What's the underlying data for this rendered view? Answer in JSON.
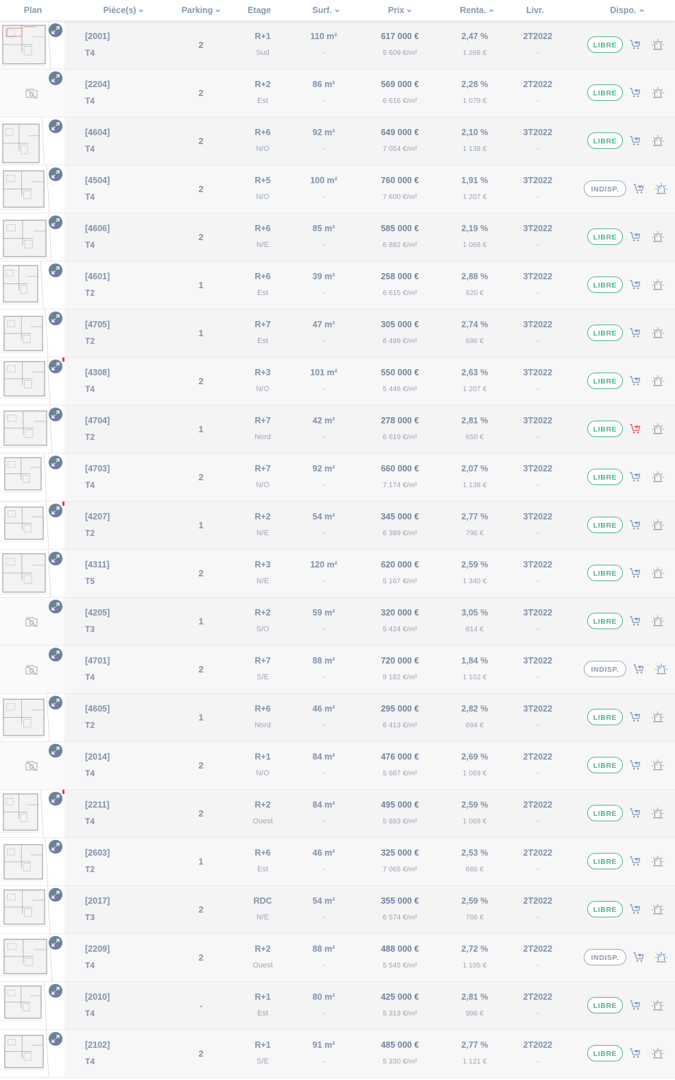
{
  "headers": {
    "plan": "Plan",
    "pieces": "Pièce(s)",
    "parking": "Parking",
    "etage": "Etage",
    "surf": "Surf.",
    "prix": "Prix",
    "renta": "Renta.",
    "livr": "Livr.",
    "dispo": "Dispo."
  },
  "colors": {
    "libre": "#4fb487",
    "indisp": "#9aa7b8",
    "cart_active": "#e05a4f",
    "zoom_bg": "#6c8099"
  },
  "rows": [
    {
      "ref": "[2001]",
      "type": "T4",
      "parking": "2",
      "etage": "R+1",
      "orient": "Sud",
      "surf": "110 m²",
      "surf_sub": "-",
      "prix": "617 000 €",
      "m2": "5 609 €/m²",
      "renta": "2,47 %",
      "loyer": "1 268 €",
      "livr": "2T2022",
      "livr_sub": "-",
      "dispo": "LIBRE",
      "plan": "image",
      "cart_active": false,
      "flag": false
    },
    {
      "ref": "[2204]",
      "type": "T4",
      "parking": "2",
      "etage": "R+2",
      "orient": "Est",
      "surf": "86 m²",
      "surf_sub": "-",
      "prix": "569 000 €",
      "m2": "6 616 €/m²",
      "renta": "2,28 %",
      "loyer": "1 079 €",
      "livr": "2T2022",
      "livr_sub": "-",
      "dispo": "LIBRE",
      "plan": "none",
      "cart_active": false,
      "flag": false
    },
    {
      "ref": "[4604]",
      "type": "T4",
      "parking": "2",
      "etage": "R+6",
      "orient": "N/O",
      "surf": "92 m²",
      "surf_sub": "-",
      "prix": "649 000 €",
      "m2": "7 054 €/m²",
      "renta": "2,10 %",
      "loyer": "1 138 €",
      "livr": "3T2022",
      "livr_sub": "-",
      "dispo": "LIBRE",
      "plan": "image",
      "cart_active": false,
      "flag": false
    },
    {
      "ref": "[4504]",
      "type": "T4",
      "parking": "2",
      "etage": "R+5",
      "orient": "N/O",
      "surf": "100 m²",
      "surf_sub": "-",
      "prix": "760 000 €",
      "m2": "7 600 €/m²",
      "renta": "1,91 %",
      "loyer": "1 207 €",
      "livr": "3T2022",
      "livr_sub": "-",
      "dispo": "INDISP.",
      "plan": "image",
      "cart_active": false,
      "flag": false
    },
    {
      "ref": "[4606]",
      "type": "T4",
      "parking": "2",
      "etage": "R+6",
      "orient": "N/E",
      "surf": "85 m²",
      "surf_sub": "-",
      "prix": "585 000 €",
      "m2": "6 882 €/m²",
      "renta": "2,19 %",
      "loyer": "1 068 €",
      "livr": "3T2022",
      "livr_sub": "-",
      "dispo": "LIBRE",
      "plan": "image",
      "cart_active": false,
      "flag": false
    },
    {
      "ref": "[4601]",
      "type": "T2",
      "parking": "1",
      "etage": "R+6",
      "orient": "Est",
      "surf": "39 m²",
      "surf_sub": "-",
      "prix": "258 000 €",
      "m2": "6 615 €/m²",
      "renta": "2,88 %",
      "loyer": "620 €",
      "livr": "3T2022",
      "livr_sub": "-",
      "dispo": "LIBRE",
      "plan": "image",
      "cart_active": false,
      "flag": false
    },
    {
      "ref": "[4705]",
      "type": "T2",
      "parking": "1",
      "etage": "R+7",
      "orient": "Est",
      "surf": "47 m²",
      "surf_sub": "-",
      "prix": "305 000 €",
      "m2": "6 489 €/m²",
      "renta": "2,74 %",
      "loyer": "696 €",
      "livr": "3T2022",
      "livr_sub": "-",
      "dispo": "LIBRE",
      "plan": "image",
      "cart_active": false,
      "flag": false
    },
    {
      "ref": "[4308]",
      "type": "T4",
      "parking": "2",
      "etage": "R+3",
      "orient": "N/O",
      "surf": "101 m²",
      "surf_sub": "-",
      "prix": "550 000 €",
      "m2": "5 446 €/m²",
      "renta": "2,63 %",
      "loyer": "1 207 €",
      "livr": "3T2022",
      "livr_sub": "-",
      "dispo": "LIBRE",
      "plan": "image",
      "cart_active": false,
      "flag": true
    },
    {
      "ref": "[4704]",
      "type": "T2",
      "parking": "1",
      "etage": "R+7",
      "orient": "Nord",
      "surf": "42 m²",
      "surf_sub": "-",
      "prix": "278 000 €",
      "m2": "6 619 €/m²",
      "renta": "2,81 %",
      "loyer": "650 €",
      "livr": "3T2022",
      "livr_sub": "-",
      "dispo": "LIBRE",
      "plan": "image",
      "cart_active": true,
      "flag": false
    },
    {
      "ref": "[4703]",
      "type": "T4",
      "parking": "2",
      "etage": "R+7",
      "orient": "N/O",
      "surf": "92 m²",
      "surf_sub": "-",
      "prix": "660 000 €",
      "m2": "7 174 €/m²",
      "renta": "2,07 %",
      "loyer": "1 138 €",
      "livr": "3T2022",
      "livr_sub": "-",
      "dispo": "LIBRE",
      "plan": "image",
      "cart_active": false,
      "flag": false
    },
    {
      "ref": "[4207]",
      "type": "T2",
      "parking": "1",
      "etage": "R+2",
      "orient": "N/E",
      "surf": "54 m²",
      "surf_sub": "-",
      "prix": "345 000 €",
      "m2": "6 389 €/m²",
      "renta": "2,77 %",
      "loyer": "796 €",
      "livr": "3T2022",
      "livr_sub": "-",
      "dispo": "LIBRE",
      "plan": "image",
      "cart_active": false,
      "flag": true
    },
    {
      "ref": "[4311]",
      "type": "T5",
      "parking": "2",
      "etage": "R+3",
      "orient": "N/E",
      "surf": "120 m²",
      "surf_sub": "-",
      "prix": "620 000 €",
      "m2": "5 167 €/m²",
      "renta": "2,59 %",
      "loyer": "1 340 €",
      "livr": "3T2022",
      "livr_sub": "-",
      "dispo": "LIBRE",
      "plan": "image",
      "cart_active": false,
      "flag": false
    },
    {
      "ref": "[4205]",
      "type": "T3",
      "parking": "1",
      "etage": "R+2",
      "orient": "S/O",
      "surf": "59 m²",
      "surf_sub": "-",
      "prix": "320 000 €",
      "m2": "5 424 €/m²",
      "renta": "3,05 %",
      "loyer": "814 €",
      "livr": "3T2022",
      "livr_sub": "-",
      "dispo": "LIBRE",
      "plan": "none",
      "cart_active": false,
      "flag": false
    },
    {
      "ref": "[4701]",
      "type": "T4",
      "parking": "2",
      "etage": "R+7",
      "orient": "S/E",
      "surf": "88 m²",
      "surf_sub": "-",
      "prix": "720 000 €",
      "m2": "8 182 €/m²",
      "renta": "1,84 %",
      "loyer": "1 102 €",
      "livr": "3T2022",
      "livr_sub": "-",
      "dispo": "INDISP.",
      "plan": "none",
      "cart_active": false,
      "flag": false
    },
    {
      "ref": "[4605]",
      "type": "T2",
      "parking": "1",
      "etage": "R+6",
      "orient": "Nord",
      "surf": "46 m²",
      "surf_sub": "-",
      "prix": "295 000 €",
      "m2": "6 413 €/m²",
      "renta": "2,82 %",
      "loyer": "694 €",
      "livr": "3T2022",
      "livr_sub": "-",
      "dispo": "LIBRE",
      "plan": "image",
      "cart_active": false,
      "flag": false
    },
    {
      "ref": "[2014]",
      "type": "T4",
      "parking": "2",
      "etage": "R+1",
      "orient": "N/O",
      "surf": "84 m²",
      "surf_sub": "-",
      "prix": "476 000 €",
      "m2": "5 667 €/m²",
      "renta": "2,69 %",
      "loyer": "1 069 €",
      "livr": "2T2022",
      "livr_sub": "-",
      "dispo": "LIBRE",
      "plan": "none",
      "cart_active": false,
      "flag": false
    },
    {
      "ref": "[2211]",
      "type": "T4",
      "parking": "2",
      "etage": "R+2",
      "orient": "Ouest",
      "surf": "84 m²",
      "surf_sub": "-",
      "prix": "495 000 €",
      "m2": "5 893 €/m²",
      "renta": "2,59 %",
      "loyer": "1 069 €",
      "livr": "2T2022",
      "livr_sub": "-",
      "dispo": "LIBRE",
      "plan": "image",
      "cart_active": false,
      "flag": true
    },
    {
      "ref": "[2603]",
      "type": "T2",
      "parking": "1",
      "etage": "R+6",
      "orient": "Est",
      "surf": "46 m²",
      "surf_sub": "-",
      "prix": "325 000 €",
      "m2": "7 065 €/m²",
      "renta": "2,53 %",
      "loyer": "686 €",
      "livr": "2T2022",
      "livr_sub": "-",
      "dispo": "LIBRE",
      "plan": "image",
      "cart_active": false,
      "flag": false
    },
    {
      "ref": "[2017]",
      "type": "T3",
      "parking": "2",
      "etage": "RDC",
      "orient": "N/E",
      "surf": "54 m²",
      "surf_sub": "-",
      "prix": "355 000 €",
      "m2": "6 574 €/m²",
      "renta": "2,59 %",
      "loyer": "766 €",
      "livr": "2T2022",
      "livr_sub": "-",
      "dispo": "LIBRE",
      "plan": "image",
      "cart_active": false,
      "flag": false
    },
    {
      "ref": "[2209]",
      "type": "T4",
      "parking": "2",
      "etage": "R+2",
      "orient": "Ouest",
      "surf": "88 m²",
      "surf_sub": "-",
      "prix": "488 000 €",
      "m2": "5 545 €/m²",
      "renta": "2,72 %",
      "loyer": "1 105 €",
      "livr": "2T2022",
      "livr_sub": "-",
      "dispo": "INDISP.",
      "plan": "image",
      "cart_active": false,
      "flag": false
    },
    {
      "ref": "[2010]",
      "type": "T4",
      "parking": "-",
      "etage": "R+1",
      "orient": "Est",
      "surf": "80 m²",
      "surf_sub": "-",
      "prix": "425 000 €",
      "m2": "5 313 €/m²",
      "renta": "2,81 %",
      "loyer": "996 €",
      "livr": "2T2022",
      "livr_sub": "-",
      "dispo": "LIBRE",
      "plan": "image",
      "cart_active": false,
      "flag": false
    },
    {
      "ref": "[2102]",
      "type": "T4",
      "parking": "2",
      "etage": "R+1",
      "orient": "S/E",
      "surf": "91 m²",
      "surf_sub": "-",
      "prix": "485 000 €",
      "m2": "5 330 €/m²",
      "renta": "2,77 %",
      "loyer": "1 121 €",
      "livr": "2T2022",
      "livr_sub": "-",
      "dispo": "LIBRE",
      "plan": "image",
      "cart_active": false,
      "flag": false
    }
  ]
}
